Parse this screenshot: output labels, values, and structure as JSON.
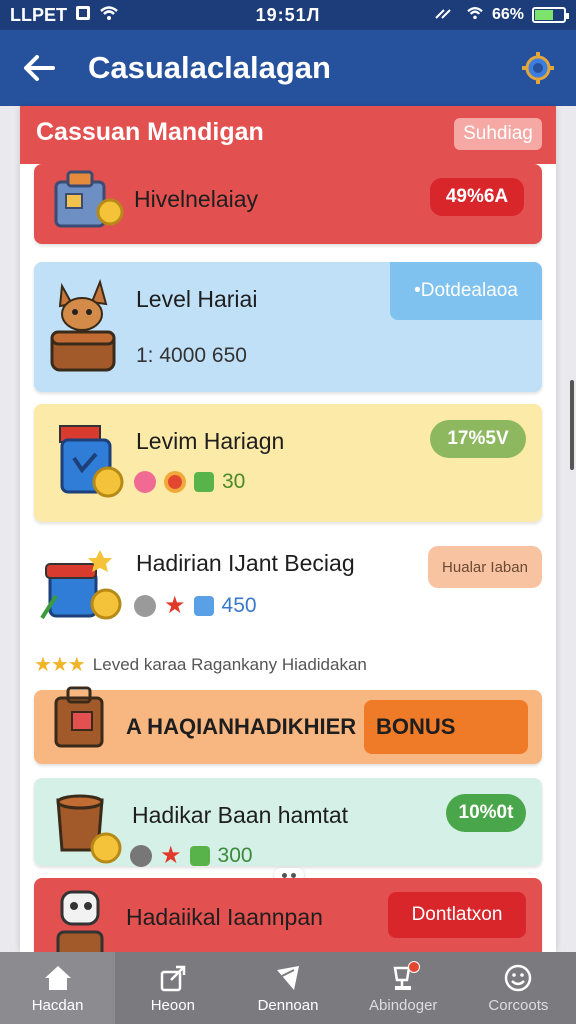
{
  "status_bar": {
    "carrier": "LLPET",
    "time": "19:51Л",
    "battery": "66%",
    "battery_level": 0.66
  },
  "app_bar": {
    "title": "Casualaclalagan",
    "back_icon": "arrow-left-icon",
    "settings_icon": "gear-icon"
  },
  "header": {
    "title": "Cassuan Mandigan",
    "button_label": "Suhdiag"
  },
  "cards": [
    {
      "title": "Hivelnelaiay",
      "badge": "49%6A",
      "color": "#e2514f",
      "badge_color": "#d9262b",
      "icon": "toolbox-icon"
    },
    {
      "title": "Level Hariai",
      "subtitle": "1: 4000  650",
      "badge": "•Dotdealaoa",
      "color": "#bfe0f7",
      "badge_color": "#7fc2ef",
      "icon": "fox-chest-icon"
    },
    {
      "title": "Levim Hariagn",
      "value": "30",
      "badge": "17%5V",
      "color": "#fbeaa8",
      "badge_color": "#8db860",
      "icon": "blue-bag-icon"
    },
    {
      "title": "Hadirian IJant Beciag",
      "value": "450",
      "badge": "Hualar Iaban",
      "color": "#ffffff",
      "badge_color": "#f8c3a0",
      "icon": "gift-box-icon"
    }
  ],
  "rating_text": "Leved karaa Ragankany Hiadidakan",
  "bonus_card": {
    "title": "A HAQIANHADIKHIER",
    "button_label": "BONUS"
  },
  "card_green": {
    "title": "Hadikar Baan hamtat",
    "value": "300",
    "badge": "10%0t"
  },
  "card_red": {
    "title": "Hadaiikal Iaannpan",
    "badge": "Dontlatxon"
  },
  "bottom_nav": [
    {
      "label": "Hacdan",
      "icon": "home-icon"
    },
    {
      "label": "Heoon",
      "icon": "share-icon"
    },
    {
      "label": "Dennoan",
      "icon": "send-icon"
    },
    {
      "label": "Abindoger",
      "icon": "trophy-icon"
    },
    {
      "label": "Corcoots",
      "icon": "smiley-icon"
    }
  ]
}
